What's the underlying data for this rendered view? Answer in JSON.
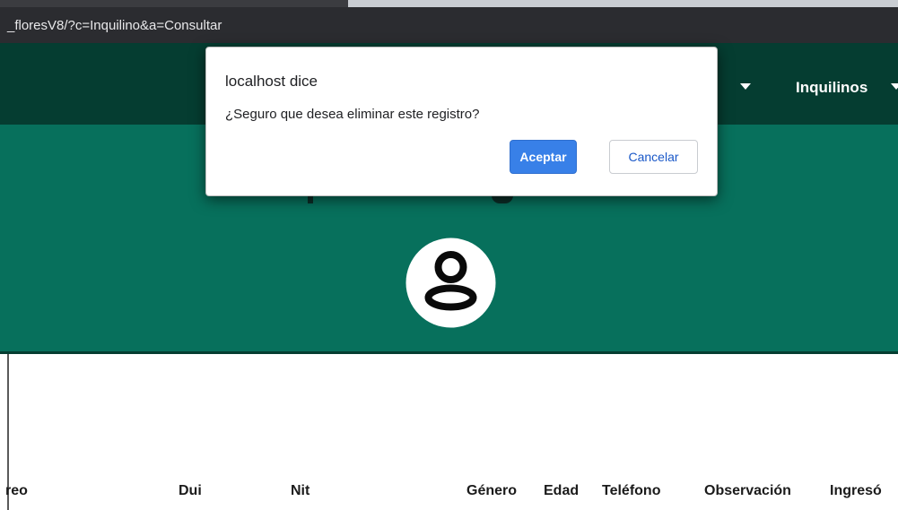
{
  "browser": {
    "url": "_floresV8/?c=Inquilino&a=Consultar"
  },
  "navbar": {
    "menu_label": "Inquilinos"
  },
  "dialog": {
    "title": "localhost dice",
    "message": "¿Seguro que desea eliminar este registro?",
    "accept_label": "Aceptar",
    "cancel_label": "Cancelar"
  },
  "table": {
    "headers": [
      "reo",
      "Dui",
      "Nit",
      "Género",
      "Edad",
      "Teléfono",
      "Observación",
      "Ingresó"
    ]
  },
  "colors": {
    "navbar": "#053d31",
    "hero": "#07705c",
    "accent_button": "#3880e8",
    "urlbar": "#2b2c30"
  },
  "icons": {
    "avatar": "user-circle-icon",
    "dropdown": "caret-down-icon"
  }
}
